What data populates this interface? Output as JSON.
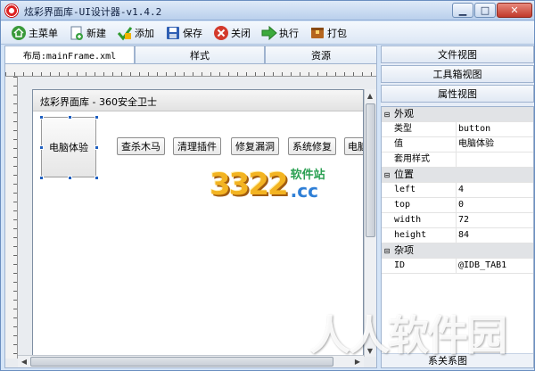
{
  "window": {
    "title": "炫彩界面库-UI设计器-v1.4.2",
    "controls": {
      "minimize": "▁",
      "maximize": "□",
      "close": "✕"
    }
  },
  "toolbar": {
    "items": [
      {
        "label": "主菜单",
        "icon": "home-icon"
      },
      {
        "label": "新建",
        "icon": "new-file-icon"
      },
      {
        "label": "添加",
        "icon": "add-icon"
      },
      {
        "label": "保存",
        "icon": "save-icon"
      },
      {
        "label": "关闭",
        "icon": "close-icon"
      },
      {
        "label": "执行",
        "icon": "run-icon"
      },
      {
        "label": "打包",
        "icon": "package-icon"
      }
    ]
  },
  "tabs": [
    {
      "label": "布局:mainFrame.xml",
      "active": true
    },
    {
      "label": "样式",
      "active": false
    },
    {
      "label": "资源",
      "active": false
    }
  ],
  "form": {
    "title": "炫彩界面库 - 360安全卫士",
    "selected_button": "电脑体验",
    "buttons": [
      "查杀木马",
      "清理插件",
      "修复漏洞",
      "系统修复",
      "电脑"
    ]
  },
  "right_panel": {
    "tabs": [
      "文件视图",
      "工具箱视图",
      "属性视图"
    ],
    "groups": [
      {
        "name": "外观",
        "rows": [
          {
            "name": "类型",
            "value": "button"
          },
          {
            "name": "值",
            "value": "电脑体验"
          },
          {
            "name": "套用样式",
            "value": ""
          }
        ]
      },
      {
        "name": "位置",
        "rows": [
          {
            "name": "left",
            "value": "4"
          },
          {
            "name": "top",
            "value": "0"
          },
          {
            "name": "width",
            "value": "72"
          },
          {
            "name": "height",
            "value": "84"
          }
        ]
      },
      {
        "name": "杂项",
        "rows": [
          {
            "name": "ID",
            "value": "@IDB_TAB1"
          }
        ]
      }
    ],
    "footer": "系关系图"
  },
  "watermarks": {
    "logo_digits": "3322",
    "logo_cn": "软件站",
    "logo_domain": ".cc",
    "site": "人人软件园"
  },
  "colors": {
    "titlebar": "#c6d8f0",
    "accent": "#1e5fc0",
    "close": "#c0392b"
  }
}
